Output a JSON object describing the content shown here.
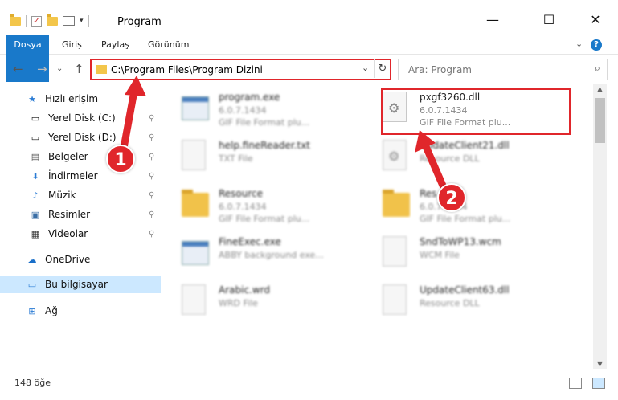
{
  "window": {
    "title": "Program",
    "minimize_glyph": "—",
    "maximize_glyph": "☐",
    "close_glyph": "✕"
  },
  "ribbon": {
    "tabs": [
      "Dosya",
      "Giriş",
      "Paylaş",
      "Görünüm"
    ],
    "expand_glyph": "⌄",
    "help_glyph": "?"
  },
  "address": {
    "back_glyph": "←",
    "forward_glyph": "→",
    "dropdown_glyph": "⌄",
    "up_glyph": "↑",
    "path": "C:\\Program Files\\Program Dizini",
    "path_dropdown_glyph": "⌄",
    "refresh_glyph": "↻",
    "search_placeholder": "Ara: Program",
    "search_glyph": "⌕"
  },
  "nav": {
    "items": [
      {
        "label": "Hızlı erişim",
        "icon": "star-icon"
      },
      {
        "label": "Yerel Disk (C:)",
        "icon": "drive-icon"
      },
      {
        "label": "Yerel Disk (D:)",
        "icon": "drive-icon"
      },
      {
        "label": "Belgeler",
        "icon": "documents-icon"
      },
      {
        "label": "İndirmeler",
        "icon": "download-icon"
      },
      {
        "label": "Müzik",
        "icon": "music-icon"
      },
      {
        "label": "Resimler",
        "icon": "pictures-icon"
      },
      {
        "label": "Videolar",
        "icon": "videos-icon"
      },
      {
        "label": "OneDrive",
        "icon": "cloud-icon"
      },
      {
        "label": "Bu bilgisayar",
        "icon": "computer-icon"
      },
      {
        "label": "Ağ",
        "icon": "network-icon"
      }
    ],
    "pin_glyph": "📌"
  },
  "files": [
    {
      "name": "program.exe",
      "line2": "6.0.7.1434",
      "line3": "GIF File Format plu...",
      "icon": "exe-icon"
    },
    {
      "name": "pxgf3260.dll",
      "line2": "6.0.7.1434",
      "line3": "GIF File Format plu...",
      "icon": "dll-icon"
    },
    {
      "name": "help.fineReader.txt",
      "line2": "TXT File",
      "line3": "",
      "icon": "text-file-icon"
    },
    {
      "name": "UpdateClient21.dll",
      "line2": "Resource DLL",
      "line3": "",
      "icon": "dll-icon"
    },
    {
      "name": "Resource",
      "line2": "6.0.7.1434",
      "line3": "GIF File Format plu...",
      "icon": "folder-icon"
    },
    {
      "name": "Res",
      "line2": "6.0.7.1434",
      "line3": "GIF File Format plu...",
      "icon": "folder-icon"
    },
    {
      "name": "FineExec.exe",
      "line2": "ABBY background exe...",
      "line3": "",
      "icon": "exe-icon"
    },
    {
      "name": "SndToWP13.wcm",
      "line2": "WCM File",
      "line3": "",
      "icon": "text-file-icon"
    },
    {
      "name": "Arabic.wrd",
      "line2": "WRD File",
      "line3": "",
      "icon": "text-file-icon"
    },
    {
      "name": "UpdateClient63.dll",
      "line2": "Resource DLL",
      "line3": "",
      "icon": "text-file-icon"
    }
  ],
  "status": {
    "item_count": "148 öğe"
  },
  "annotations": {
    "callout_1": "1",
    "callout_2": "2",
    "color": "#e0262b"
  }
}
